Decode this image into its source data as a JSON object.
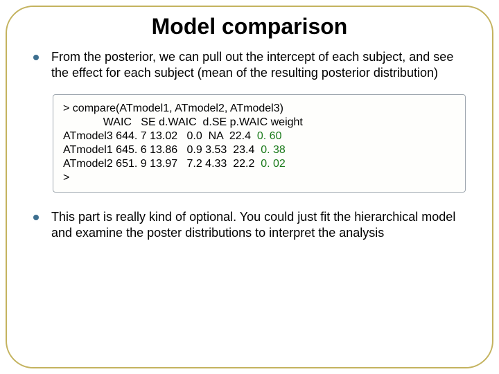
{
  "title": "Model comparison",
  "bullets": {
    "b1": "From the posterior, we can pull out the intercept of each subject, and see the effect for each subject (mean of the resulting posterior distribution)",
    "b2": "This part is really kind of optional. You could just fit the hierarchical model and examine the poster distributions to interpret the analysis"
  },
  "code": {
    "l1": "> compare(ATmodel1, ATmodel2, ATmodel3)",
    "l2": "             WAIC   SE d.WAIC  d.SE p.WAIC weight",
    "l3a": "ATmodel3 644. 7 13.02   0.0  NA  22.4  ",
    "l3b": "0. 60",
    "l4a": "ATmodel1 645. 6 13.86   0.9 3.53  23.4  ",
    "l4b": "0. 38",
    "l5a": "ATmodel2 651. 9 13.97   7.2 4.33  22.2  ",
    "l5b": "0. 02",
    "l6": ">"
  }
}
